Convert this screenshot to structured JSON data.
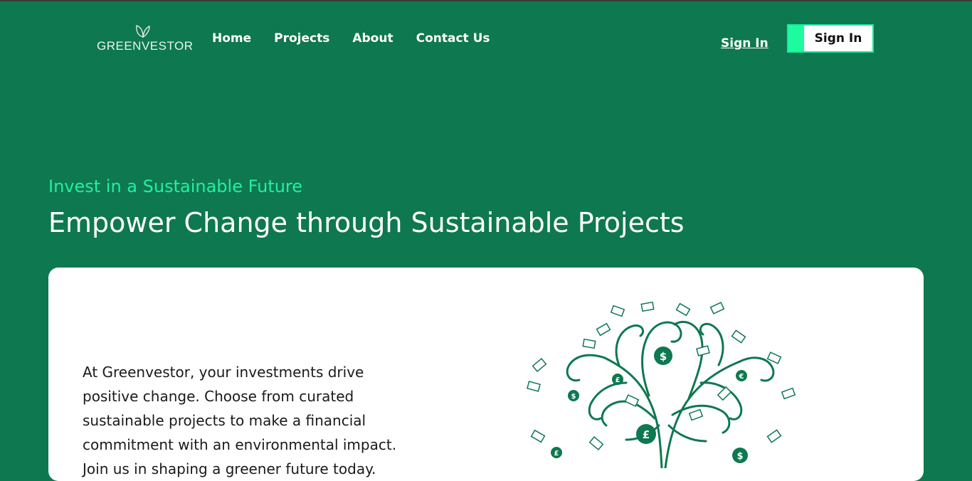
{
  "header": {
    "logo_text": "GREENVESTOR",
    "nav": [
      "Home",
      "Projects",
      "About",
      "Contact Us"
    ],
    "sign_in_link": "Sign In",
    "sign_in_button": "Sign In"
  },
  "hero": {
    "tagline": "Invest in a Sustainable Future",
    "headline": "Empower Change through Sustainable Projects"
  },
  "card": {
    "body": "At Greenvestor, your investments drive positive change. Choose from curated sustainable projects to make a financial commitment with an environmental impact. Join us in shaping a greener future today."
  },
  "colors": {
    "background": "#0e7850",
    "accent": "#22f0a0",
    "button_accent": "#1cfb9e",
    "card": "#ffffff"
  }
}
